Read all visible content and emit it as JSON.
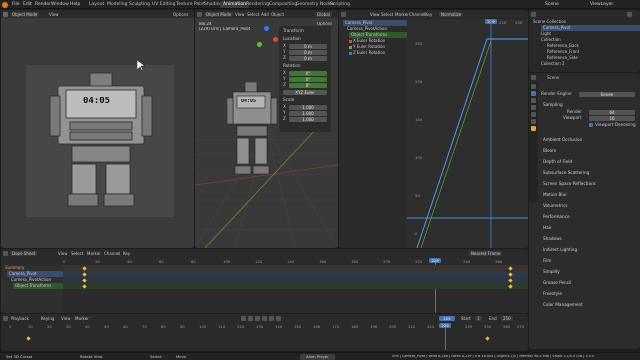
{
  "app": {
    "scene": "Scene",
    "view_layer": "ViewLayer"
  },
  "top_menu": [
    "File",
    "Edit",
    "Render",
    "Window",
    "Help"
  ],
  "workspaces": [
    "Layout",
    "Modeling",
    "Sculpting",
    "UV Editing",
    "Texture Paint",
    "Shading",
    "Animation",
    "Rendering",
    "Compositing",
    "Geometry Nodes",
    "Scripting"
  ],
  "camera_view": {
    "mode": "Object Mode",
    "view": "View",
    "options": "Options",
    "clock_text": "04:05"
  },
  "viewport": {
    "mode": "Object Mode",
    "menus": [
      "View",
      "Select",
      "Add",
      "Object"
    ],
    "transform": "Global",
    "options": "Options",
    "info_line1": "Blo.24",
    "info_line2": "(229) Urls | Camera_Pivot"
  },
  "n_panel": {
    "transform_title": "Transform",
    "location_label": "Location",
    "location": [
      "0 m",
      "0 m",
      "0 m"
    ],
    "rotation_label": "Rotation",
    "rotation": [
      "0°",
      "0°",
      "0°"
    ],
    "rotation_mode": "XYZ Euler",
    "scale_label": "Scale",
    "scale": [
      "1.000",
      "1.000",
      "1.000"
    ],
    "axes": [
      "X",
      "Y",
      "Z"
    ],
    "tabs": [
      "Item",
      "Tool",
      "View"
    ]
  },
  "graph_outliner": {
    "items": [
      "Camera_Pivot",
      "Camera_PivotAction",
      "Object Transforms",
      "X Euler Rotation",
      "Y Euler Rotation",
      "Z Euler Rotation"
    ]
  },
  "graph_editor": {
    "menus": [
      "View",
      "Select",
      "Marker",
      "Channel",
      "Key"
    ],
    "normalize": "Normalize",
    "ticks": [
      "220",
      "229",
      "240",
      "250"
    ],
    "current_frame": "229",
    "y_ticks": [
      "250",
      "200",
      "150",
      "100",
      "50",
      "0"
    ]
  },
  "outliner": {
    "title": "Scene Collection",
    "items": [
      "Camera_Pivot",
      "Light",
      "Collection",
      "Reference_Back",
      "Reference_Front",
      "Reference_Side",
      "Collection 2",
      "Robot"
    ]
  },
  "properties": {
    "render_engine_label": "Render Engine",
    "render_engine": "Eevee",
    "sampling": "Sampling",
    "render_label": "Render",
    "render_value": "64",
    "viewport_label": "Viewport",
    "viewport_value": "16",
    "viewport_denoising": "Viewport Denoising",
    "sections": [
      "Ambient Occlusion",
      "Bloom",
      "Depth of Field",
      "Subsurface Scattering",
      "Screen Space Reflections",
      "Motion Blur",
      "Volumetrics",
      "Performance",
      "Hair",
      "Shadows",
      "Indirect Lighting",
      "Film",
      "Simplify",
      "Grease Pencil",
      "Freestyle",
      "Color Management"
    ]
  },
  "dopesheet": {
    "mode": "Dope Sheet",
    "menus": [
      "View",
      "Select",
      "Marker",
      "Channel",
      "Key"
    ],
    "nearest": "Nearest Frame",
    "channels": [
      "Summary",
      "Camera_Pivot",
      "Camera_PivotAction",
      "Object Transforms"
    ],
    "ticks": [
      "0",
      "20",
      "40",
      "60",
      "80",
      "100",
      "120",
      "140",
      "160",
      "180",
      "200",
      "220",
      "240",
      "260"
    ],
    "current_frame": "229"
  },
  "timeline": {
    "playback": "Playback",
    "keying": "Keying",
    "view": "View",
    "marker": "Marker",
    "start_label": "Start",
    "start": "1",
    "end_label": "End",
    "end": "250",
    "current_frame": "229",
    "ticks": [
      "0",
      "10",
      "20",
      "30",
      "40",
      "50",
      "60",
      "70",
      "80",
      "90",
      "100",
      "110",
      "120",
      "130",
      "140",
      "150",
      "160",
      "170",
      "180",
      "190",
      "200",
      "210",
      "220",
      "230",
      "240",
      "250",
      "260",
      "270"
    ]
  },
  "status": {
    "left": [
      "Set 3D Cursor",
      "Rotate View",
      "Select"
    ],
    "middle": "Move",
    "anim_player": "Anim Player",
    "right": "Urls | Camera_Pivot | Verts 8,168 | Faces 8,229 | Tris 16,004 | Objects 1/5 | Memory 98.5 MiB | VRAM 1.1/4.0 GiB | 3.0.0"
  },
  "colors": {
    "accent": "#4772b3",
    "keyframe": "#e8c24a",
    "curve": "#4aa8ff",
    "panel": "#303030"
  }
}
